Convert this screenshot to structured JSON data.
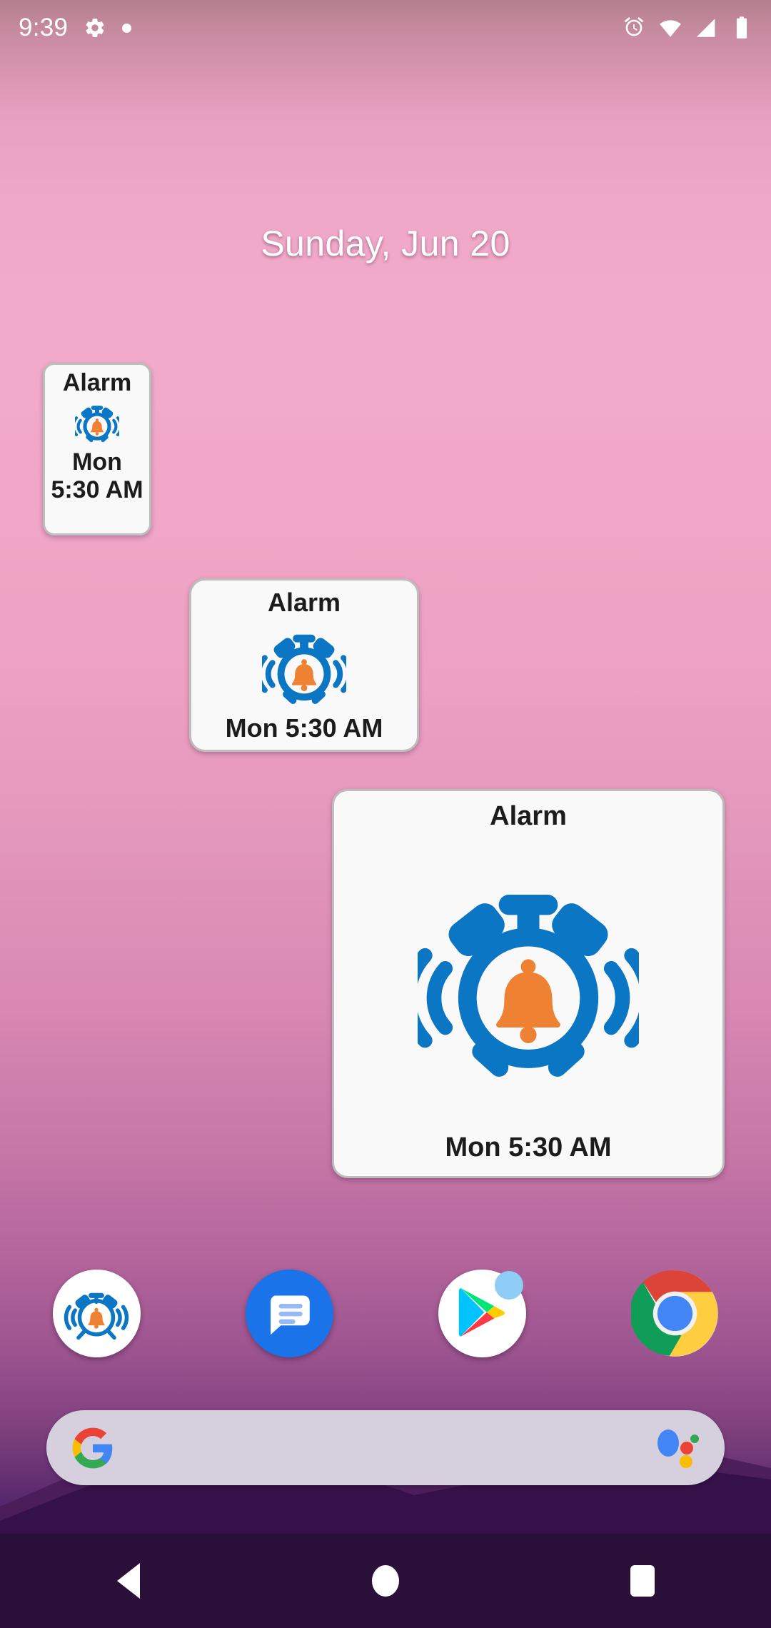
{
  "statusbar": {
    "time": "9:39",
    "left_icons": [
      "gear-icon",
      "dot-icon"
    ],
    "right_icons": [
      "alarm-icon",
      "wifi-icon",
      "signal-icon",
      "battery-icon"
    ]
  },
  "homescreen": {
    "date": "Sunday, Jun 20"
  },
  "widgets": [
    {
      "id": "small",
      "title": "Alarm",
      "time": "Mon 5:30 AM",
      "icon": "alarm-clock-icon",
      "size": "1x1"
    },
    {
      "id": "medium",
      "title": "Alarm",
      "time": "Mon 5:30 AM",
      "icon": "alarm-clock-icon",
      "size": "2x2"
    },
    {
      "id": "large",
      "title": "Alarm",
      "time": "Mon 5:30 AM",
      "icon": "alarm-clock-icon",
      "size": "3x3"
    }
  ],
  "dock": {
    "apps": [
      {
        "name": "Alarm",
        "icon": "alarm-app-icon",
        "badge": false
      },
      {
        "name": "Messages",
        "icon": "messages-app-icon",
        "badge": false
      },
      {
        "name": "Play Store",
        "icon": "play-store-app-icon",
        "badge": true
      },
      {
        "name": "Chrome",
        "icon": "chrome-app-icon",
        "badge": false
      }
    ]
  },
  "search": {
    "placeholder": "",
    "value": "",
    "left_icon": "google-g-icon",
    "right_icon": "google-assistant-icon"
  },
  "navbar": {
    "back": "Back",
    "home": "Home",
    "recents": "Recent apps"
  },
  "colors": {
    "alarm_blue": "#0b76c4",
    "bell_orange": "#ef8133",
    "widget_bg": "#f9f9f9",
    "widget_border": "#bdbdbd",
    "searchbar_bg": "#d6d0de",
    "navbar_bg": "#2a1038"
  }
}
